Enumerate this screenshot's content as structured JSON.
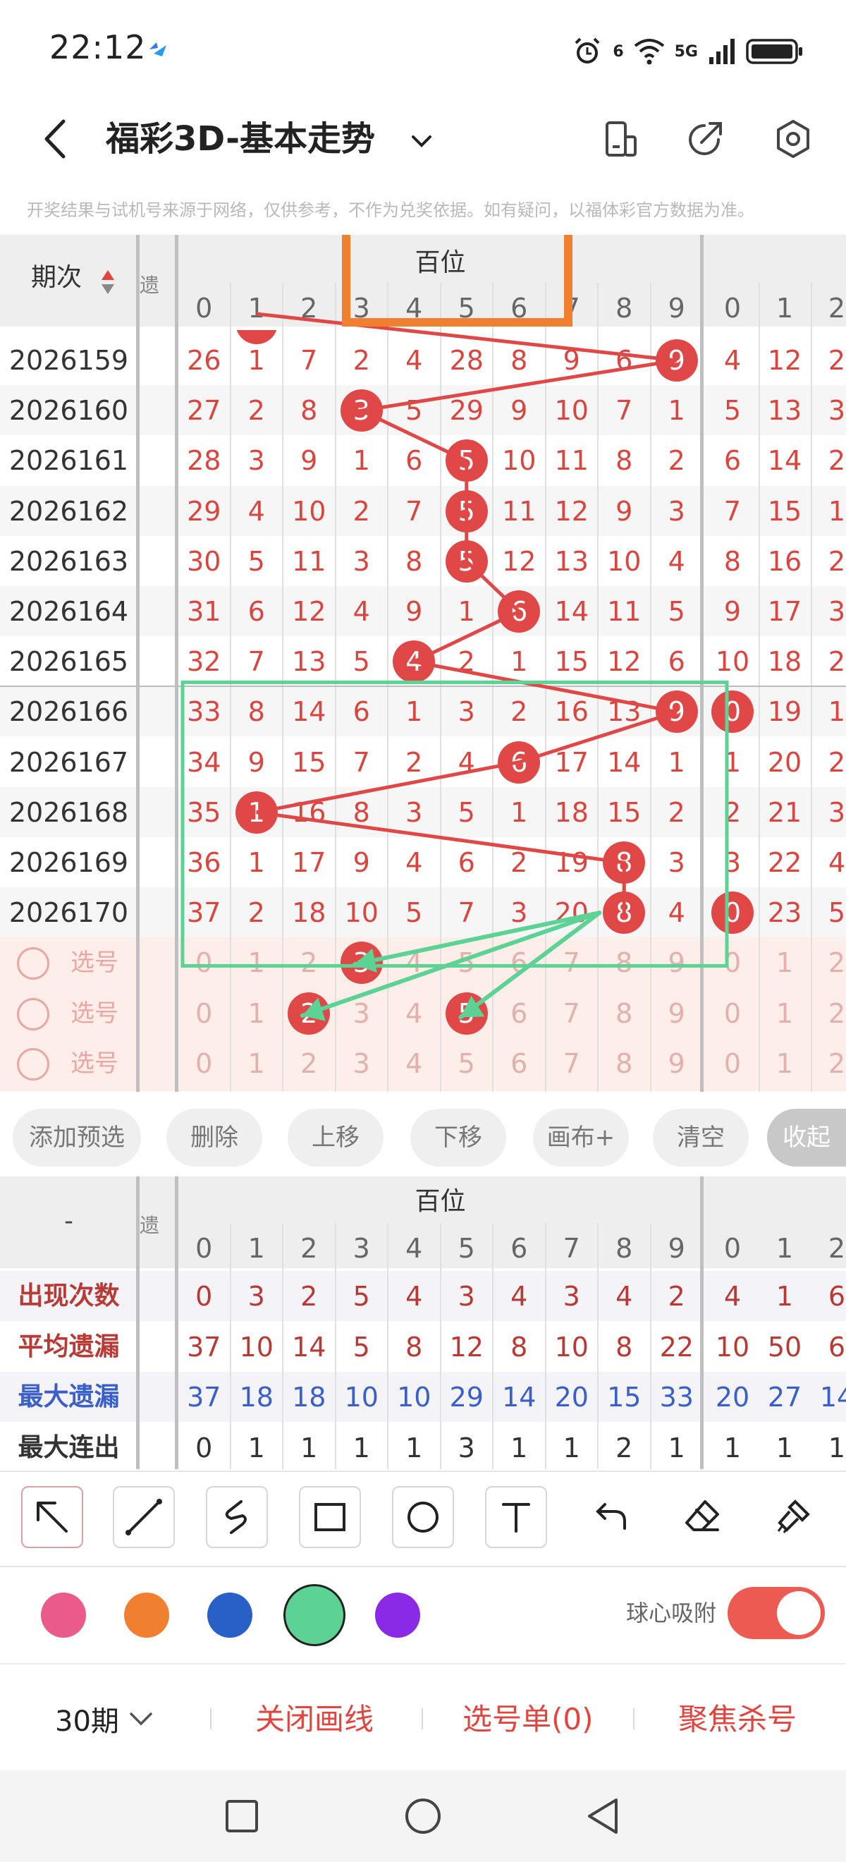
{
  "status": {
    "time": "22:12",
    "net_6": "6",
    "net_5g": "5G"
  },
  "header": {
    "title": "福彩3D-基本走势"
  },
  "disclaimer": "开奖结果与试机号来源于网络，仅供参考，不作为兑奖依据。如有疑问，以福体彩官方数据为准。",
  "grid": {
    "period_header": "期次",
    "side_tab": "遗",
    "position_header": "百位",
    "digits": [
      "0",
      "1",
      "2",
      "3",
      "4",
      "5",
      "6",
      "7",
      "8",
      "9"
    ],
    "next_digits": [
      "0",
      "1",
      "2"
    ],
    "rows": [
      {
        "period": "2026159",
        "cells": [
          "26",
          "1",
          "7",
          "2",
          "4",
          "28",
          "8",
          "9",
          "6",
          "9"
        ],
        "hit": 9,
        "next": [
          "4",
          "12",
          "2"
        ]
      },
      {
        "period": "2026160",
        "cells": [
          "27",
          "2",
          "8",
          "3",
          "5",
          "29",
          "9",
          "10",
          "7",
          "1"
        ],
        "hit": 3,
        "next": [
          "5",
          "13",
          "3"
        ]
      },
      {
        "period": "2026161",
        "cells": [
          "28",
          "3",
          "9",
          "1",
          "6",
          "5",
          "10",
          "11",
          "8",
          "2"
        ],
        "hit": 5,
        "next": [
          "6",
          "14",
          "2"
        ]
      },
      {
        "period": "2026162",
        "cells": [
          "29",
          "4",
          "10",
          "2",
          "7",
          "5",
          "11",
          "12",
          "9",
          "3"
        ],
        "hit": 5,
        "next": [
          "7",
          "15",
          "1"
        ]
      },
      {
        "period": "2026163",
        "cells": [
          "30",
          "5",
          "11",
          "3",
          "8",
          "5",
          "12",
          "13",
          "10",
          "4"
        ],
        "hit": 5,
        "next": [
          "8",
          "16",
          "2"
        ]
      },
      {
        "period": "2026164",
        "cells": [
          "31",
          "6",
          "12",
          "4",
          "9",
          "1",
          "6",
          "14",
          "11",
          "5"
        ],
        "hit": 6,
        "next": [
          "9",
          "17",
          "3"
        ]
      },
      {
        "period": "2026165",
        "cells": [
          "32",
          "7",
          "13",
          "5",
          "4",
          "2",
          "1",
          "15",
          "12",
          "6"
        ],
        "hit": 4,
        "next": [
          "10",
          "18",
          "2"
        ]
      },
      {
        "period": "2026166",
        "cells": [
          "33",
          "8",
          "14",
          "6",
          "1",
          "3",
          "2",
          "16",
          "13",
          "9"
        ],
        "hit": 9,
        "next": [
          "0",
          "19",
          "1"
        ]
      },
      {
        "period": "2026167",
        "cells": [
          "34",
          "9",
          "15",
          "7",
          "2",
          "4",
          "6",
          "17",
          "14",
          "1"
        ],
        "hit": 6,
        "next": [
          "1",
          "20",
          "2"
        ]
      },
      {
        "period": "2026168",
        "cells": [
          "35",
          "1",
          "16",
          "8",
          "3",
          "5",
          "1",
          "18",
          "15",
          "2"
        ],
        "hit": 1,
        "next": [
          "2",
          "21",
          "3"
        ]
      },
      {
        "period": "2026169",
        "cells": [
          "36",
          "1",
          "17",
          "9",
          "4",
          "6",
          "2",
          "19",
          "8",
          "3"
        ],
        "hit": 8,
        "next": [
          "3",
          "22",
          "4"
        ]
      },
      {
        "period": "2026170",
        "cells": [
          "37",
          "2",
          "18",
          "10",
          "5",
          "7",
          "3",
          "20",
          "8",
          "4"
        ],
        "hit": 8,
        "next": [
          "0",
          "23",
          "5"
        ]
      }
    ],
    "select_label": "选号",
    "select_rows": [
      {
        "picked": 3
      },
      {
        "picked": [
          2,
          5
        ]
      },
      {
        "picked": null
      }
    ]
  },
  "actions": [
    "添加预选",
    "删除",
    "上移",
    "下移",
    "画布+",
    "清空",
    "收起"
  ],
  "stats": {
    "corner": "-",
    "side_tab": "遗",
    "position_header": "百位",
    "rows": [
      {
        "label": "出现次数",
        "values": [
          "0",
          "3",
          "2",
          "5",
          "4",
          "3",
          "4",
          "3",
          "4",
          "2"
        ],
        "next": [
          "4",
          "1",
          "6"
        ]
      },
      {
        "label": "平均遗漏",
        "values": [
          "37",
          "10",
          "14",
          "5",
          "8",
          "12",
          "8",
          "10",
          "8",
          "22"
        ],
        "next": [
          "10",
          "50",
          "6"
        ]
      },
      {
        "label": "最大遗漏",
        "values": [
          "37",
          "18",
          "18",
          "10",
          "10",
          "29",
          "14",
          "20",
          "15",
          "33"
        ],
        "next": [
          "20",
          "27",
          "14"
        ]
      },
      {
        "label": "最大连出",
        "values": [
          "0",
          "1",
          "1",
          "1",
          "1",
          "3",
          "1",
          "1",
          "2",
          "1"
        ],
        "next": [
          "1",
          "1",
          "1"
        ]
      }
    ]
  },
  "colors": {
    "brand_red": "#e04848",
    "pink": "#ea5a8a",
    "orange": "#f08030",
    "blue": "#2860c8",
    "green": "#5cd294",
    "purple": "#8a2ae6"
  },
  "snap_label": "球心吸附",
  "bottom": {
    "periods": "30期",
    "close_lines": "关闭画线",
    "picks": "选号单(0)",
    "focus_kill": "聚焦杀号"
  }
}
